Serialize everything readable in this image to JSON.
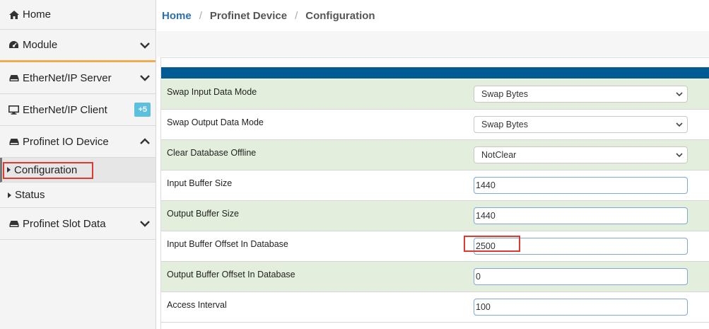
{
  "sidebar": {
    "home": "Home",
    "module": "Module",
    "ethernet_ip_server": "EtherNet/IP Server",
    "ethernet_ip_client": "EtherNet/IP Client",
    "ethernet_ip_client_badge": "+5",
    "profinet_io_device": "Profinet IO Device",
    "sub_configuration": "Configuration",
    "sub_status": "Status",
    "profinet_slot_data": "Profinet Slot Data",
    "accent_color": "#f0ad4e",
    "badge_color": "#5bc0de"
  },
  "breadcrumb": {
    "home": "Home",
    "device": "Profinet Device",
    "page": "Configuration"
  },
  "form": {
    "header_color": "#005a94",
    "rows": [
      {
        "label": "Swap Input Data Mode",
        "type": "select",
        "value": "Swap Bytes"
      },
      {
        "label": "Swap Output Data Mode",
        "type": "select",
        "value": "Swap Bytes"
      },
      {
        "label": "Clear Database Offline",
        "type": "select",
        "value": "NotClear"
      },
      {
        "label": "Input Buffer Size",
        "type": "input",
        "value": "1440"
      },
      {
        "label": "Output Buffer Size",
        "type": "input",
        "value": "1440"
      },
      {
        "label": "Input Buffer Offset In Database",
        "type": "input",
        "value": "2500"
      },
      {
        "label": "Output Buffer Offset In Database",
        "type": "input",
        "value": "0"
      },
      {
        "label": "Access Interval",
        "type": "input",
        "value": "100"
      }
    ]
  }
}
